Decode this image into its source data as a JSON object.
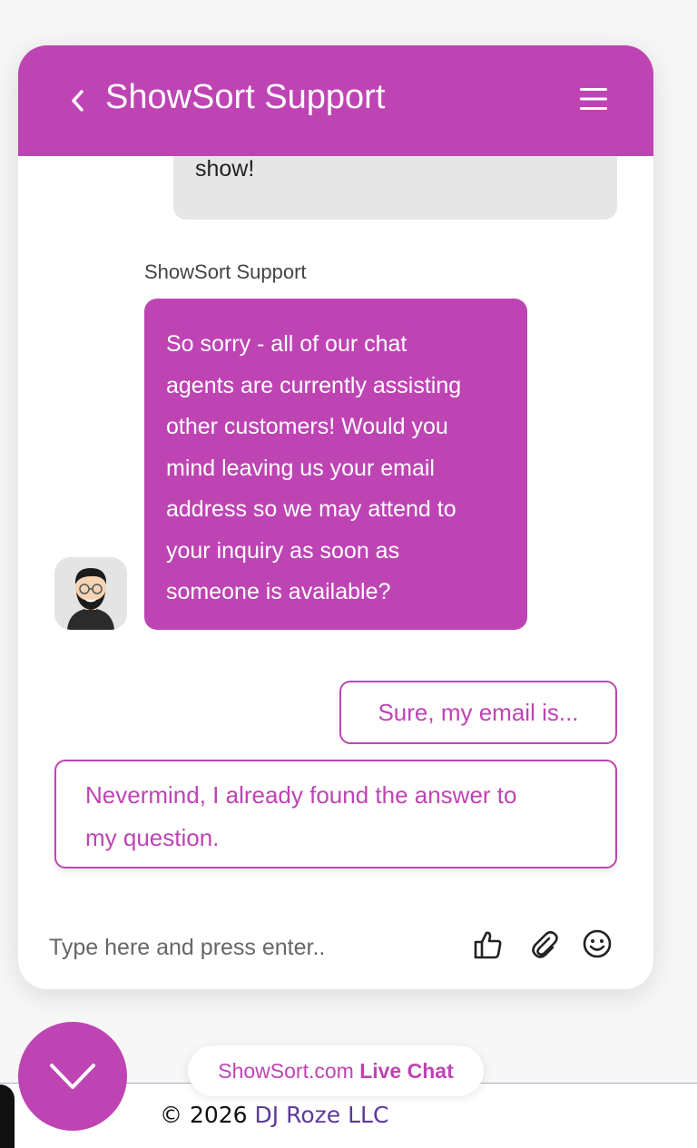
{
  "header": {
    "title": "ShowSort Support",
    "back_icon": "chevron-left-icon",
    "menu_icon": "hamburger-menu-icon"
  },
  "messages": {
    "previous_user_tail": "show!",
    "agent_name": "ShowSort Support",
    "agent_lines": [
      "So sorry - all of our chat",
      "agents are currently assisting",
      "other customers! Would you",
      "mind leaving us your email",
      "address so we may attend to",
      "your inquiry as soon as",
      "someone is available?"
    ]
  },
  "quick_replies": {
    "email": "Sure, my email is...",
    "nevermind_lines": [
      "Nevermind, I already found the answer to",
      "my question."
    ]
  },
  "composer": {
    "placeholder": "Type here and press enter..",
    "icons": [
      "thumbs-up-icon",
      "paperclip-icon",
      "smiley-icon"
    ]
  },
  "launcher": {
    "brand_prefix": "ShowSort.com",
    "brand_bold": "Live Chat",
    "toggle_icon": "chevron-down-icon"
  },
  "footer": {
    "copyright_prefix": "© 2026",
    "company": "DJ Roze LLC"
  },
  "colors": {
    "accent": "#be44b4",
    "user_bubble": "#e6e6e6",
    "company_link": "#5b3a99"
  }
}
